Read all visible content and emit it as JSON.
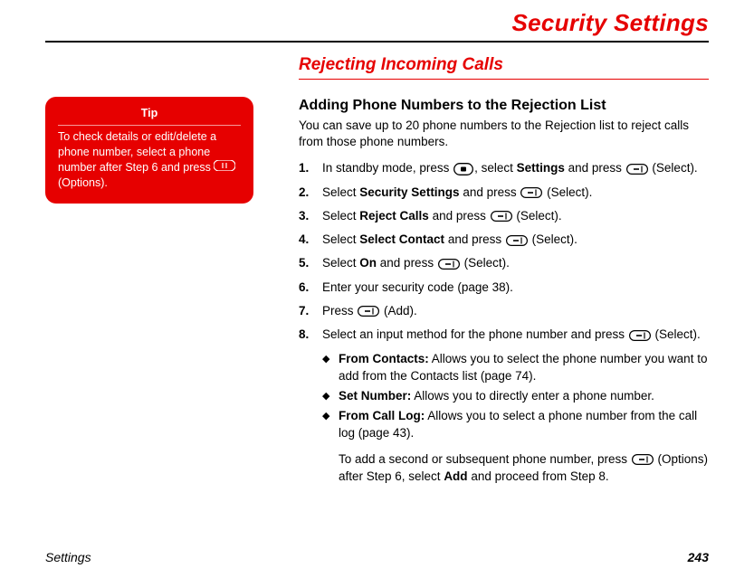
{
  "header": {
    "title": "Security Settings"
  },
  "section": {
    "heading": "Rejecting Incoming Calls"
  },
  "sub": {
    "heading": "Adding Phone Numbers to the Rejection List",
    "intro": "You can save up to 20 phone numbers to the Rejection list to reject calls from those phone numbers."
  },
  "tip": {
    "title": "Tip",
    "body_pre": "To check details or edit/delete a phone number, select a phone number after Step 6 and press ",
    "body_post": " (Options)."
  },
  "steps": {
    "s1_a": "In standby mode, press ",
    "s1_b": ", select ",
    "s1_settings": "Settings",
    "s1_c": " and press ",
    "s1_d": " (Select).",
    "s2_a": "Select ",
    "s2_sec": "Security Settings",
    "s2_b": " and press ",
    "s2_c": " (Select).",
    "s3_a": "Select ",
    "s3_rej": "Reject Calls",
    "s3_b": " and press ",
    "s3_c": " (Select).",
    "s4_a": "Select ",
    "s4_sel": "Select Contact",
    "s4_b": " and press ",
    "s4_c": " (Select).",
    "s5_a": "Select ",
    "s5_on": "On",
    "s5_b": " and press ",
    "s5_c": " (Select).",
    "s6": "Enter your security code (page 38).",
    "s7_a": "Press ",
    "s7_b": " (Add).",
    "s8_a": "Select an input method for the phone number and press ",
    "s8_b": " (Select)."
  },
  "bullets": {
    "b1_label": "From Contacts:",
    "b1_text": " Allows you to select the phone number you want to add  from the Contacts list (page 74).",
    "b2_label": "Set Number:",
    "b2_text": " Allows you to directly enter a phone number.",
    "b3_label": "From Call Log:",
    "b3_text": " Allows you to select a phone number from the call log (page 43)."
  },
  "note": {
    "a": "To add a second or subsequent phone number, press ",
    "b": " (Options) after Step 6, select ",
    "add": "Add",
    "c": " and proceed from Step 8."
  },
  "footer": {
    "left": "Settings",
    "page": "243"
  }
}
